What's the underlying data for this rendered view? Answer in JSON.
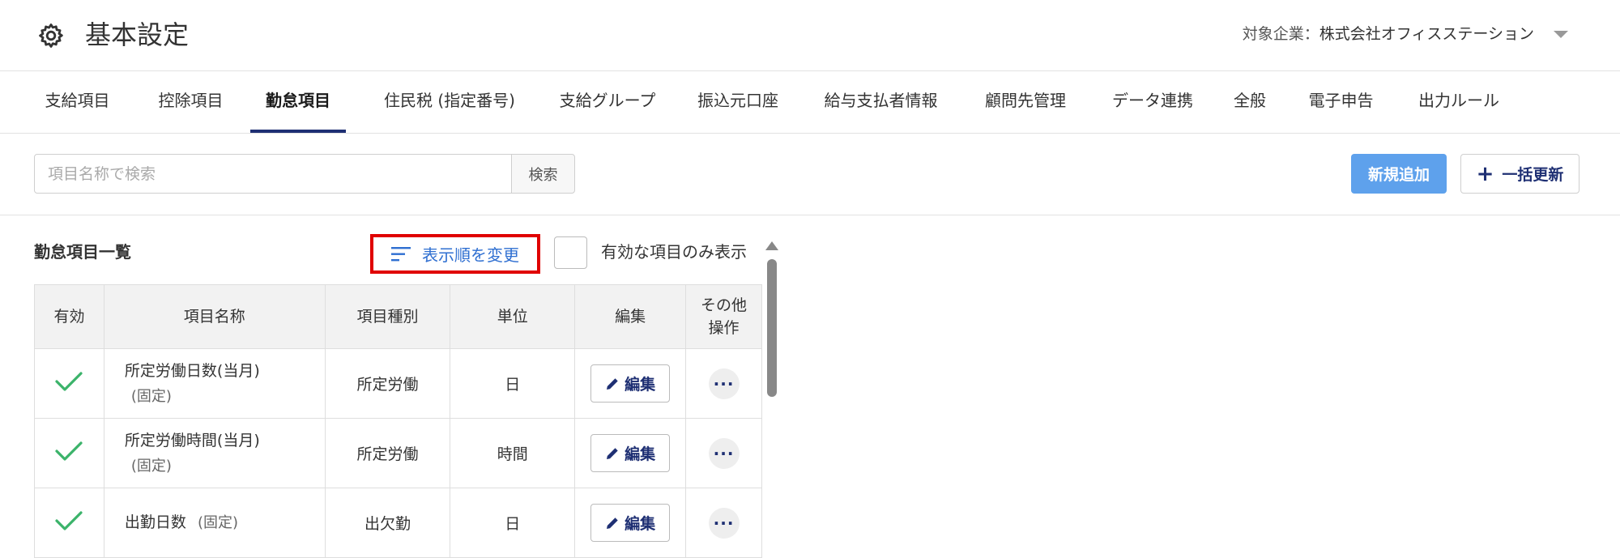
{
  "header": {
    "title": "基本設定",
    "gear_icon": "gear-icon",
    "company_label": "対象企業：",
    "company_name": "株式会社オフィスステーション"
  },
  "tabs": [
    {
      "label": "支給項目"
    },
    {
      "label": "控除項目"
    },
    {
      "label": "勤怠項目",
      "active": true
    },
    {
      "label": "住民税 (指定番号)"
    },
    {
      "label": "支給グループ"
    },
    {
      "label": "振込元口座"
    },
    {
      "label": "給与支払者情報"
    },
    {
      "label": "顧問先管理"
    },
    {
      "label": "データ連携"
    },
    {
      "label": "全般"
    },
    {
      "label": "電子申告"
    },
    {
      "label": "出力ルール"
    }
  ],
  "search": {
    "placeholder": "項目名称で検索",
    "value": "",
    "button_label": "検索"
  },
  "toolbar": {
    "add_label": "新規追加",
    "bulk_update_label": "一括更新",
    "add_color": "#5ea1ec"
  },
  "list": {
    "title": "勤怠項目一覧",
    "reorder_label": "表示順を変更",
    "only_valid_label": "有効な項目のみ表示",
    "only_valid_checked": false,
    "highlight_color": "#e00000"
  },
  "table": {
    "columns": [
      "有効",
      "項目名称",
      "項目種別",
      "単位",
      "編集",
      "その他\n操作"
    ],
    "rows": [
      {
        "valid": true,
        "name": "所定労働日数(当月)",
        "fixed": "(固定)",
        "fixed_wrap": true,
        "type": "所定労働",
        "unit": "日",
        "edit_label": "編集"
      },
      {
        "valid": true,
        "name": "所定労働時間(当月)",
        "fixed": "(固定)",
        "fixed_wrap": true,
        "type": "所定労働",
        "unit": "時間",
        "edit_label": "編集"
      },
      {
        "valid": true,
        "name": "出勤日数",
        "fixed": "(固定)",
        "fixed_wrap": false,
        "type": "出欠勤",
        "unit": "日",
        "edit_label": "編集"
      }
    ],
    "check_color": "#3bb36a"
  }
}
